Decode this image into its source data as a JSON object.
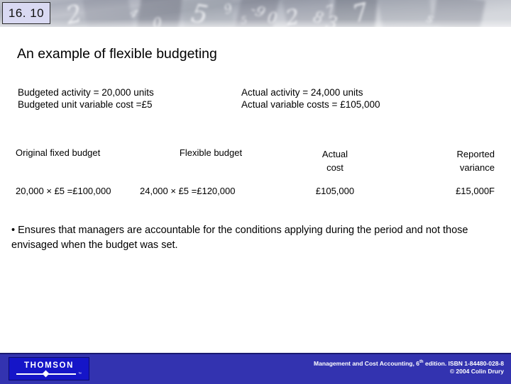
{
  "slide": {
    "number": "16. 10",
    "title": "An example of flexible budgeting"
  },
  "assumptions": {
    "budgeted_activity": "Budgeted activity = 20,000 units",
    "budgeted_unit_variable_cost": "Budgeted unit variable cost =£5",
    "actual_activity": "Actual activity = 24,000 units",
    "actual_variable_costs": "Actual variable costs = £105,000"
  },
  "comparison": {
    "headers": {
      "original_fixed_budget": "Original fixed budget",
      "flexible_budget": "Flexible budget",
      "actual_cost_line1": "Actual",
      "actual_cost_line2": "cost",
      "reported_variance_line1": "Reported",
      "reported_variance_line2": "variance"
    },
    "row": {
      "original_fixed_budget": "20,000 × £5 =£100,000",
      "flexible_budget": "24,000 × £5 =£120,000",
      "actual_cost": "£105,000",
      "reported_variance": "£15,000F"
    }
  },
  "bullet": {
    "marker": "•",
    "text": "Ensures that managers are accountable for the conditions applying during the period and not those envisaged when the budget was set."
  },
  "footer": {
    "logo_word": "THOMSON",
    "logo_tm": "™",
    "line1_pre": "Management and Cost Accounting, 6",
    "line1_sup": "th",
    "line1_post": " edition. ISBN 1-84480-028-8",
    "line2": "© 2004 Colin Drury"
  },
  "colors": {
    "footer_bar": "#3333b0",
    "logo_box": "#1515c8",
    "slide_number_fill": "#d9d9f2"
  }
}
